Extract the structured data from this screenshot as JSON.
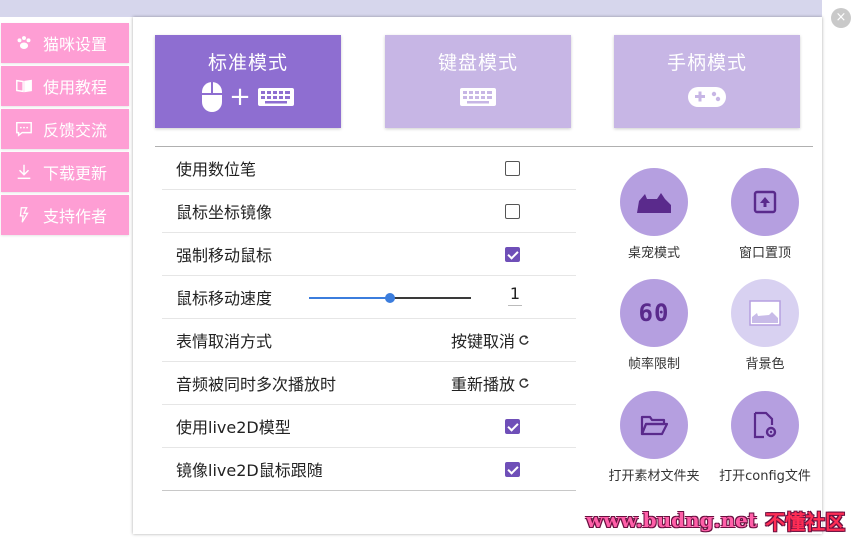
{
  "window": {
    "close_glyph": "×"
  },
  "sidebar": {
    "items": [
      {
        "label": "猫咪设置",
        "icon": "paw-icon"
      },
      {
        "label": "使用教程",
        "icon": "book-icon"
      },
      {
        "label": "反馈交流",
        "icon": "chat-icon"
      },
      {
        "label": "下载更新",
        "icon": "download-icon"
      },
      {
        "label": "支持作者",
        "icon": "lightning-icon"
      }
    ]
  },
  "modes": [
    {
      "label": "标准模式",
      "active": true,
      "plus": "+"
    },
    {
      "label": "键盘模式",
      "active": false
    },
    {
      "label": "手柄模式",
      "active": false
    }
  ],
  "settings": [
    {
      "label": "使用数位笔",
      "type": "checkbox",
      "checked": false
    },
    {
      "label": "鼠标坐标镜像",
      "type": "checkbox",
      "checked": false
    },
    {
      "label": "强制移动鼠标",
      "type": "checkbox",
      "checked": true
    },
    {
      "label": "鼠标移动速度",
      "type": "slider",
      "value": "1",
      "level": 0.5
    },
    {
      "label": "表情取消方式",
      "type": "cycle",
      "value": "按键取消"
    },
    {
      "label": "音频被同时多次播放时",
      "type": "cycle",
      "value": "重新播放"
    },
    {
      "label": "使用live2D模型",
      "type": "checkbox",
      "checked": true
    },
    {
      "label": "镜像live2D鼠标跟随",
      "type": "checkbox",
      "checked": true
    }
  ],
  "tools": [
    {
      "label": "桌宠模式",
      "icon": "cat-silhouette-icon"
    },
    {
      "label": "窗口置顶",
      "icon": "pin-top-icon"
    },
    {
      "label": "帧率限制",
      "icon": "fps-60-icon",
      "badge": "60"
    },
    {
      "label": "背景色",
      "icon": "background-image-icon"
    },
    {
      "label": "打开素材文件夹",
      "icon": "folder-open-icon"
    },
    {
      "label": "打开config文件",
      "icon": "config-file-icon"
    }
  ],
  "watermark": {
    "url": "www.budng.net",
    "brand": "不懂社区"
  },
  "colors": {
    "accent": "#8e6ed1",
    "accent_light": "#c7b6e5",
    "sidebar_pink": "#fe9ed4",
    "check_purple": "#6f4fb8",
    "slider_blue": "#3b7ddd"
  }
}
